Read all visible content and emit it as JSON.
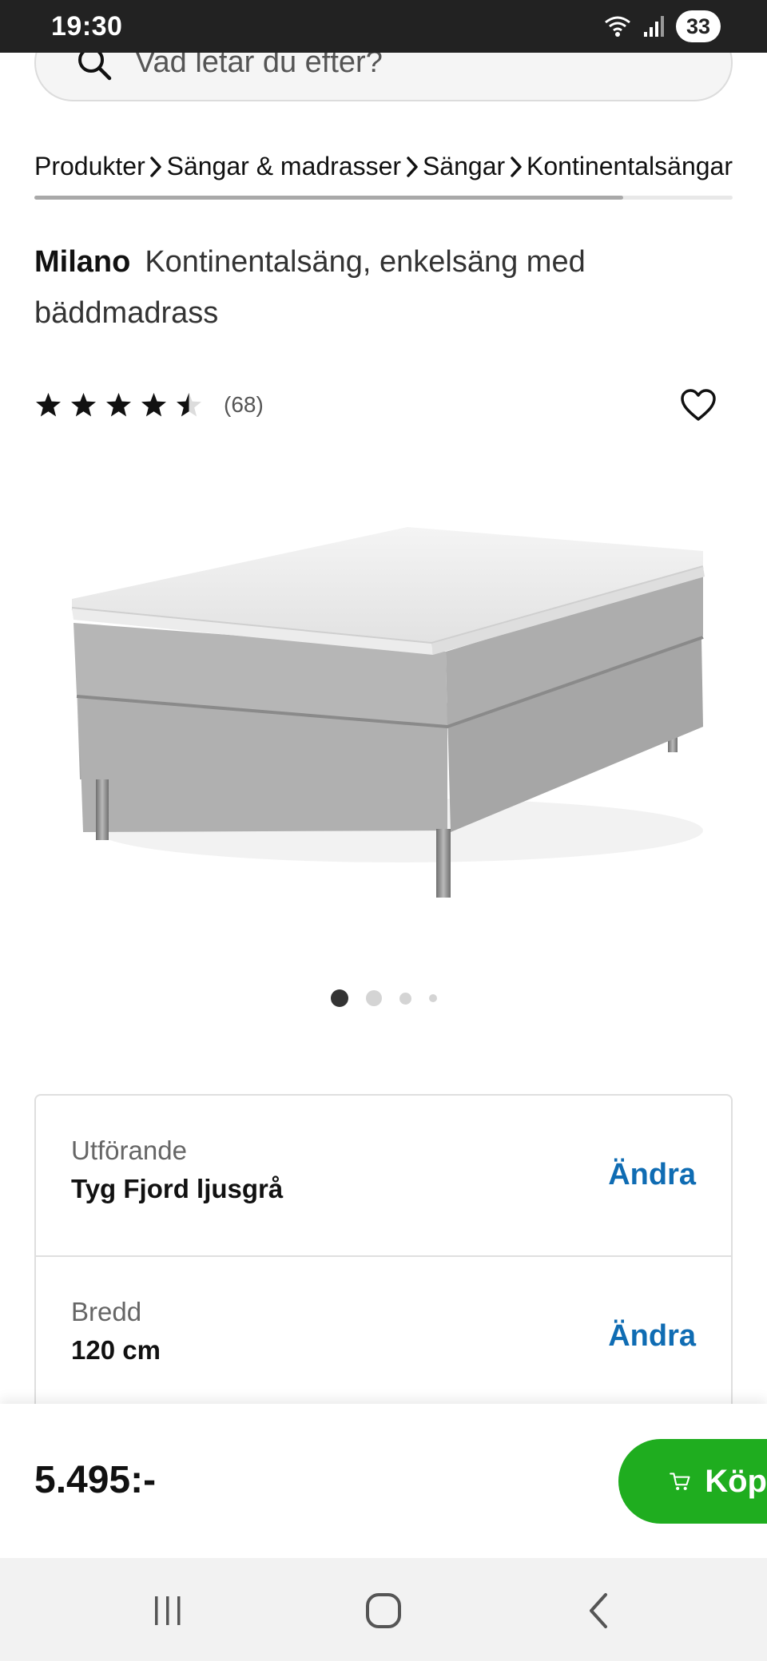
{
  "status_bar": {
    "time": "19:30",
    "battery": "33"
  },
  "search": {
    "placeholder": "Vad letar du efter?"
  },
  "breadcrumbs": [
    "Produkter",
    "Sängar & madrasser",
    "Sängar",
    "Kontinentalsängar"
  ],
  "product": {
    "name": "Milano",
    "description": "Kontinentalsäng, enkelsäng med bäddmadrass",
    "rating": 4.5,
    "rating_max": 5,
    "review_count": "(68)"
  },
  "gallery": {
    "image_count": 4,
    "active_index": 0
  },
  "options": [
    {
      "label": "Utförande",
      "value": "Tyg Fjord ljusgrå",
      "action": "Ändra"
    },
    {
      "label": "Bredd",
      "value": "120 cm",
      "action": "Ändra"
    }
  ],
  "purchase": {
    "price": "5.495:-",
    "buy_label": "Köp"
  },
  "colors": {
    "accent_link": "#0f6cb3",
    "buy_button": "#1fad1f",
    "status_bar": "#222222"
  },
  "icons": [
    "search-icon",
    "chevron-right-icon",
    "star-icon",
    "heart-icon",
    "cart-icon",
    "recent-apps-icon",
    "home-icon",
    "back-icon",
    "wifi-icon",
    "signal-icon"
  ]
}
